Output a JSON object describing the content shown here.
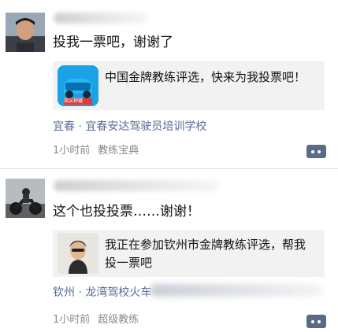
{
  "posts": [
    {
      "text": "投我一票吧，谢谢了",
      "card_title": "中国金牌教练评选，快来为我投票吧！",
      "app_badge": "指尖神器",
      "location": "宜春 · 宜春安达驾驶员培训学校",
      "time": "1小时前",
      "source": "教练宝典"
    },
    {
      "text": "这个也投投票……谢谢！",
      "card_title": "我正在参加钦州市金牌教练评选，帮我投一票吧",
      "location": "钦州 · 龙湾驾校火车",
      "time": "1小时前",
      "source": "超级教练"
    }
  ],
  "colors": {
    "link": "#576b95",
    "meta": "#8a8a8a",
    "card_bg": "#f2f2f2",
    "comment_btn": "#5a6b87"
  },
  "icons": [
    "avatar-photo",
    "car-app-icon",
    "comment-icon"
  ]
}
